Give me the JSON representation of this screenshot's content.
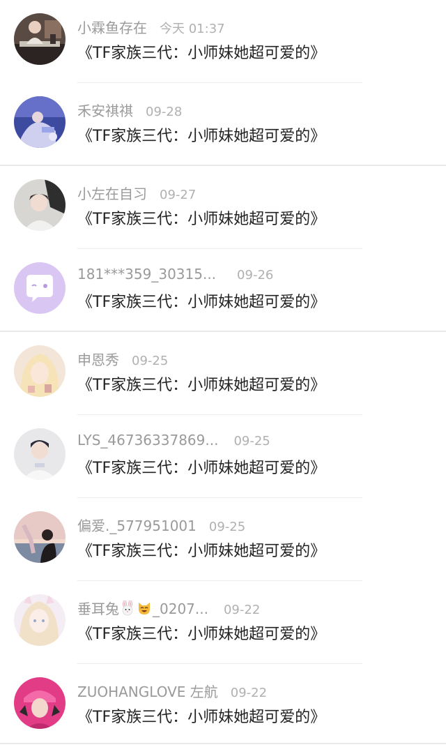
{
  "comments": [
    {
      "username": "小霖鱼存在",
      "time": "今天 01:37",
      "message": "《TF家族三代：小师妹她超可爱的》",
      "avatar_icon": "person-at-desk-avatar"
    },
    {
      "username": "禾安祺祺",
      "time": "09-28",
      "message": "《TF家族三代：小师妹她超可爱的》",
      "avatar_icon": "concert-stage-avatar"
    },
    {
      "username": "小左在自习",
      "time": "09-27",
      "message": "《TF家族三代：小师妹她超可爱的》",
      "avatar_icon": "boy-portrait-avatar"
    },
    {
      "username": "181***359_30315...",
      "time": "09-26",
      "message": "《TF家族三代：小师妹她超可爱的》",
      "avatar_icon": "default-chat-bubble-avatar"
    },
    {
      "username": "申恩秀",
      "time": "09-25",
      "message": "《TF家族三代：小师妹她超可爱的》",
      "avatar_icon": "blonde-girl-avatar"
    },
    {
      "username": "LYS_46736337869...",
      "time": "09-25",
      "message": "《TF家族三代：小师妹她超可爱的》",
      "avatar_icon": "boy-white-shirt-avatar"
    },
    {
      "username": "偏爱._577951001",
      "time": "09-25",
      "message": "《TF家族三代：小师妹她超可爱的》",
      "avatar_icon": "sunset-couple-avatar"
    },
    {
      "username_prefix": "垂耳兔",
      "username_suffix": "_0207...",
      "time": "09-22",
      "message": "《TF家族三代：小师妹她超可爱的》",
      "avatar_icon": "anime-girl-avatar"
    },
    {
      "username": "ZUOHANGLOVE 左航",
      "time": "09-22",
      "message": "《TF家族三代：小师妹她超可爱的》",
      "avatar_icon": "pink-hat-boy-avatar"
    }
  ],
  "colors": {
    "username": "#9a9a9a",
    "time": "#b0b0b0",
    "message": "#222222",
    "divider": "#ececec",
    "default_avatar_bg": "#d9c6f2"
  }
}
